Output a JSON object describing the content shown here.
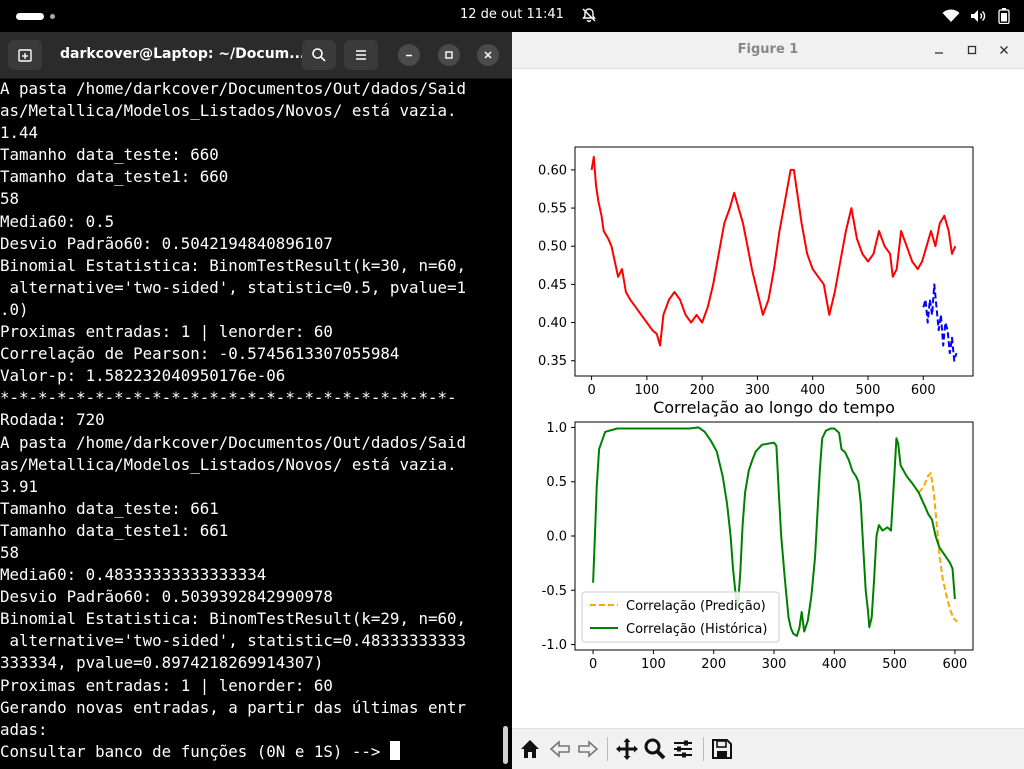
{
  "topbar": {
    "clock": "12 de out  11:41",
    "tray_icons": [
      "wifi-icon",
      "volume-icon",
      "battery-icon"
    ]
  },
  "terminal": {
    "title": "darkcover@Laptop: ~/Docum...",
    "lines": [
      "A pasta /home/darkcover/Documentos/Out/dados/Said",
      "as/Metallica/Modelos_Listados/Novos/ está vazia.",
      "1.44",
      "Tamanho data_teste: 660",
      "Tamanho data_teste1: 660",
      "58",
      "Media60: 0.5",
      "Desvio Padrão60: 0.5042194840896107",
      "Binomial Estatistica: BinomTestResult(k=30, n=60,",
      " alternative='two-sided', statistic=0.5, pvalue=1",
      ".0)",
      "Proximas entradas: 1 | lenorder: 60",
      "Correlação de Pearson: -0.5745613307055984",
      "Valor-p: 1.582232040950176e-06",
      "*-*-*-*-*-*-*-*-*-*-*-*-*-*-*-*-*-*-*-*-*-*-*-*-",
      "Rodada: 720",
      "A pasta /home/darkcover/Documentos/Out/dados/Said",
      "as/Metallica/Modelos_Listados/Novos/ está vazia.",
      "3.91",
      "Tamanho data_teste: 661",
      "Tamanho data_teste1: 661",
      "58",
      "Media60: 0.48333333333333334",
      "Desvio Padrão60: 0.5039392842990978",
      "Binomial Estatistica: BinomTestResult(k=29, n=60,",
      " alternative='two-sided', statistic=0.48333333333",
      "333334, pvalue=0.8974218269914307)",
      "Proximas entradas: 1 | lenorder: 60",
      "Gerando novas entradas, a partir das últimas entr",
      "adas:"
    ],
    "prompt": "Consultar banco de funções (0N e 1S) --> "
  },
  "figure": {
    "title": "Figure 1",
    "toolbar": [
      "home-icon",
      "back-icon",
      "forward-icon",
      "pan-icon",
      "zoom-icon",
      "configure-subplots-icon",
      "save-icon"
    ]
  },
  "chart_data": [
    {
      "type": "line",
      "title": "",
      "xlim": [
        -30,
        690
      ],
      "ylim": [
        0.33,
        0.63
      ],
      "xticks": [
        0,
        100,
        200,
        300,
        400,
        500,
        600
      ],
      "yticks": [
        0.35,
        0.4,
        0.45,
        0.5,
        0.55,
        0.6
      ],
      "series": [
        {
          "color": "#ff0000",
          "style": "solid",
          "points": [
            [
              0,
              0.6
            ],
            [
              4,
              0.617
            ],
            [
              8,
              0.58
            ],
            [
              12,
              0.56
            ],
            [
              18,
              0.54
            ],
            [
              22,
              0.52
            ],
            [
              30,
              0.51
            ],
            [
              36,
              0.5
            ],
            [
              42,
              0.48
            ],
            [
              48,
              0.46
            ],
            [
              55,
              0.47
            ],
            [
              62,
              0.44
            ],
            [
              70,
              0.43
            ],
            [
              80,
              0.42
            ],
            [
              90,
              0.41
            ],
            [
              100,
              0.4
            ],
            [
              110,
              0.39
            ],
            [
              118,
              0.385
            ],
            [
              124,
              0.37
            ],
            [
              130,
              0.41
            ],
            [
              140,
              0.43
            ],
            [
              150,
              0.44
            ],
            [
              160,
              0.43
            ],
            [
              170,
              0.41
            ],
            [
              180,
              0.4
            ],
            [
              190,
              0.41
            ],
            [
              200,
              0.4
            ],
            [
              210,
              0.42
            ],
            [
              220,
              0.45
            ],
            [
              230,
              0.49
            ],
            [
              240,
              0.53
            ],
            [
              250,
              0.55
            ],
            [
              258,
              0.57
            ],
            [
              266,
              0.55
            ],
            [
              274,
              0.53
            ],
            [
              282,
              0.5
            ],
            [
              290,
              0.47
            ],
            [
              300,
              0.44
            ],
            [
              310,
              0.41
            ],
            [
              320,
              0.43
            ],
            [
              330,
              0.47
            ],
            [
              340,
              0.52
            ],
            [
              350,
              0.56
            ],
            [
              360,
              0.6
            ],
            [
              366,
              0.6
            ],
            [
              372,
              0.57
            ],
            [
              380,
              0.53
            ],
            [
              390,
              0.49
            ],
            [
              400,
              0.47
            ],
            [
              410,
              0.46
            ],
            [
              420,
              0.45
            ],
            [
              430,
              0.41
            ],
            [
              440,
              0.44
            ],
            [
              450,
              0.48
            ],
            [
              460,
              0.52
            ],
            [
              470,
              0.55
            ],
            [
              480,
              0.51
            ],
            [
              490,
              0.49
            ],
            [
              500,
              0.48
            ],
            [
              510,
              0.49
            ],
            [
              520,
              0.52
            ],
            [
              530,
              0.5
            ],
            [
              540,
              0.49
            ],
            [
              545,
              0.46
            ],
            [
              552,
              0.47
            ],
            [
              560,
              0.52
            ],
            [
              570,
              0.5
            ],
            [
              580,
              0.48
            ],
            [
              590,
              0.47
            ],
            [
              598,
              0.48
            ],
            [
              606,
              0.5
            ],
            [
              614,
              0.52
            ],
            [
              622,
              0.5
            ],
            [
              630,
              0.53
            ],
            [
              638,
              0.54
            ],
            [
              646,
              0.52
            ],
            [
              652,
              0.49
            ],
            [
              658,
              0.5
            ]
          ]
        },
        {
          "color": "#0000ff",
          "style": "dashed",
          "points": [
            [
              600,
              0.42
            ],
            [
              604,
              0.43
            ],
            [
              608,
              0.4
            ],
            [
              612,
              0.43
            ],
            [
              616,
              0.41
            ],
            [
              620,
              0.45
            ],
            [
              624,
              0.42
            ],
            [
              628,
              0.39
            ],
            [
              632,
              0.41
            ],
            [
              636,
              0.37
            ],
            [
              640,
              0.4
            ],
            [
              644,
              0.39
            ],
            [
              648,
              0.36
            ],
            [
              652,
              0.38
            ],
            [
              656,
              0.35
            ],
            [
              660,
              0.36
            ]
          ]
        }
      ]
    },
    {
      "type": "line",
      "title": "Correlação ao longo do tempo",
      "xlim": [
        -30,
        630
      ],
      "ylim": [
        -1.05,
        1.05
      ],
      "xticks": [
        0,
        100,
        200,
        300,
        400,
        500,
        600
      ],
      "yticks": [
        -1.0,
        -0.5,
        0.0,
        0.5,
        1.0
      ],
      "legend": {
        "position": "lower-left"
      },
      "series": [
        {
          "name": "Correlação (Predição)",
          "color": "#ffa500",
          "style": "dashed",
          "points": [
            [
              540,
              0.4
            ],
            [
              548,
              0.45
            ],
            [
              555,
              0.55
            ],
            [
              560,
              0.58
            ],
            [
              565,
              0.4
            ],
            [
              570,
              0.1
            ],
            [
              575,
              -0.2
            ],
            [
              580,
              -0.4
            ],
            [
              586,
              -0.55
            ],
            [
              592,
              -0.68
            ],
            [
              598,
              -0.76
            ],
            [
              604,
              -0.79
            ]
          ]
        },
        {
          "name": "Correlação (Histórica)",
          "color": "#008000",
          "style": "solid",
          "points": [
            [
              0,
              -0.43
            ],
            [
              3,
              0.0
            ],
            [
              6,
              0.45
            ],
            [
              10,
              0.8
            ],
            [
              20,
              0.96
            ],
            [
              40,
              0.99
            ],
            [
              80,
              0.99
            ],
            [
              120,
              0.99
            ],
            [
              160,
              0.99
            ],
            [
              175,
              1.0
            ],
            [
              185,
              0.96
            ],
            [
              195,
              0.88
            ],
            [
              205,
              0.78
            ],
            [
              215,
              0.55
            ],
            [
              222,
              0.3
            ],
            [
              228,
              0.0
            ],
            [
              232,
              -0.3
            ],
            [
              238,
              -0.62
            ],
            [
              240,
              -0.65
            ],
            [
              244,
              -0.35
            ],
            [
              248,
              0.1
            ],
            [
              252,
              0.4
            ],
            [
              258,
              0.6
            ],
            [
              264,
              0.7
            ],
            [
              270,
              0.78
            ],
            [
              280,
              0.84
            ],
            [
              290,
              0.85
            ],
            [
              300,
              0.86
            ],
            [
              304,
              0.83
            ],
            [
              308,
              0.4
            ],
            [
              312,
              0.0
            ],
            [
              318,
              -0.4
            ],
            [
              324,
              -0.75
            ],
            [
              328,
              -0.85
            ],
            [
              332,
              -0.9
            ],
            [
              338,
              -0.92
            ],
            [
              342,
              -0.85
            ],
            [
              346,
              -0.7
            ],
            [
              350,
              -0.88
            ],
            [
              356,
              -0.78
            ],
            [
              362,
              -0.55
            ],
            [
              368,
              -0.2
            ],
            [
              372,
              0.2
            ],
            [
              376,
              0.6
            ],
            [
              380,
              0.9
            ],
            [
              386,
              0.97
            ],
            [
              394,
              0.99
            ],
            [
              400,
              0.99
            ],
            [
              408,
              0.95
            ],
            [
              412,
              0.8
            ],
            [
              418,
              0.77
            ],
            [
              424,
              0.7
            ],
            [
              430,
              0.6
            ],
            [
              436,
              0.55
            ],
            [
              440,
              0.5
            ],
            [
              444,
              0.3
            ],
            [
              448,
              -0.1
            ],
            [
              452,
              -0.5
            ],
            [
              456,
              -0.7
            ],
            [
              458,
              -0.84
            ],
            [
              462,
              -0.75
            ],
            [
              466,
              -0.4
            ],
            [
              470,
              0.0
            ],
            [
              474,
              0.1
            ],
            [
              480,
              0.05
            ],
            [
              488,
              0.08
            ],
            [
              494,
              0.05
            ],
            [
              500,
              0.6
            ],
            [
              503,
              0.9
            ],
            [
              506,
              0.85
            ],
            [
              510,
              0.65
            ],
            [
              520,
              0.55
            ],
            [
              530,
              0.48
            ],
            [
              540,
              0.4
            ],
            [
              548,
              0.3
            ],
            [
              556,
              0.2
            ],
            [
              562,
              0.15
            ],
            [
              568,
              0.0
            ],
            [
              574,
              -0.1
            ],
            [
              580,
              -0.15
            ],
            [
              586,
              -0.2
            ],
            [
              592,
              -0.25
            ],
            [
              596,
              -0.3
            ],
            [
              600,
              -0.58
            ]
          ]
        }
      ]
    }
  ]
}
